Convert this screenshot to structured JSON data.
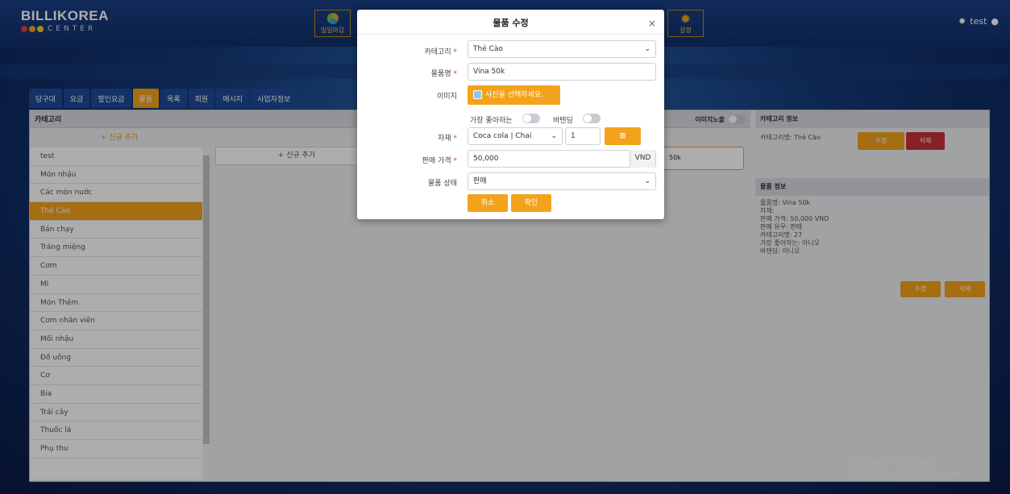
{
  "header": {
    "logo_title": "BILLIKOREA",
    "logo_sub": "CENTER",
    "tile_close": "일일마감",
    "tile_settings": "설정",
    "user_name": "test"
  },
  "tabs": [
    "당구대",
    "요금",
    "할인요금",
    "물품",
    "목록",
    "회원",
    "메시지",
    "사업자정보"
  ],
  "active_tab_index": 3,
  "category_panel": {
    "header": "카테고리",
    "add_label": "+ 신규 추가",
    "items": [
      "test",
      "Món nhậu",
      "Các món nuớc",
      "Thẻ Cào",
      "Bán chạy",
      "Tráng miệng",
      "Cơm",
      "Mì",
      "Món Thêm",
      "Cơm nhân viên",
      "Mồi nhậu",
      "Đồ uống",
      "Cơ",
      "Bia",
      "Trái cây",
      "Thuốc lá",
      "Phụ thu"
    ],
    "active_index": 3
  },
  "items_panel": {
    "add_label": "+ 신규 추가",
    "card_label": "50k",
    "image_expose_label": "이미지노출"
  },
  "category_info": {
    "header": "카테고리 정보",
    "name_line": "카테고리명: Thẻ Cào",
    "edit": "수정",
    "delete": "삭제"
  },
  "item_info": {
    "header": "물품 정보",
    "lines": [
      "물품명: Vina 50k",
      "자재:",
      "판매 가격: 50,000 VND",
      "판매 유무: 판매",
      "카테고리명: 27",
      "가장 좋아하는: 아니오",
      "바텐딩: 아니오"
    ],
    "edit": "수정",
    "delete": "삭제"
  },
  "modal": {
    "title": "물품 수정",
    "close": "×",
    "category_label": "카테고리",
    "category_value": "Thẻ Cào",
    "name_label": "물품명",
    "name_value": "Vina 50k",
    "image_label": "이미지",
    "photo_button": "사진을 선택하세요.",
    "favorite_label": "가장 좋아하는",
    "bartending_label": "바텐딩",
    "material_label": "자재",
    "material_value": "Coca cola  |  Chai",
    "qty_value": "1",
    "plus_icon": "plus-square-icon",
    "price_label": "판매 가격",
    "price_value": "50,000",
    "currency": "VND",
    "status_label": "물품 상태",
    "status_value": "판매",
    "cancel": "취소",
    "confirm": "확인",
    "required_mark": "*"
  },
  "watermark": {
    "line1": "Activate Windows",
    "line2": "Go to Settings to activate Windows."
  },
  "colors": {
    "accent": "#f3a31b",
    "danger": "#c9303a",
    "nav": "#1e4a98"
  }
}
